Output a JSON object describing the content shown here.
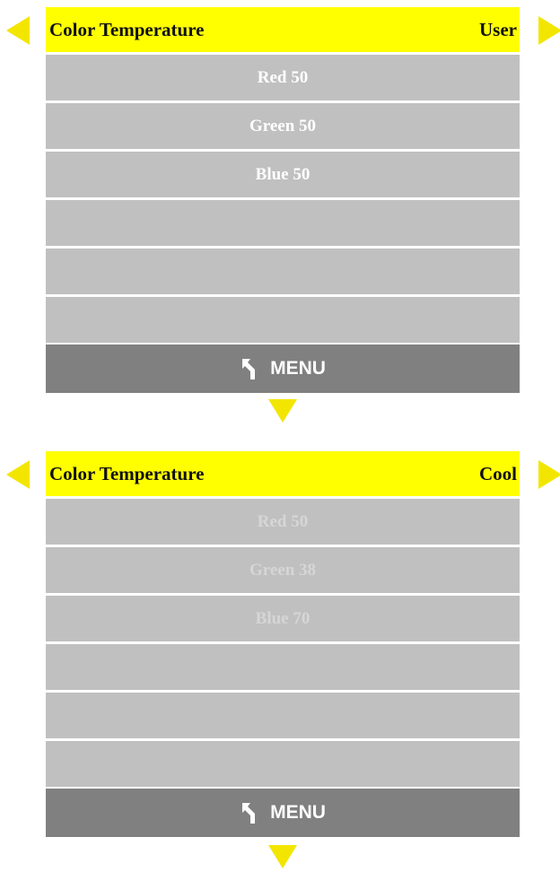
{
  "colors": {
    "header_bg": "#ffff00",
    "arrow": "#f2e600",
    "row_bg": "#c0c0c0",
    "footer_bg": "#808080"
  },
  "panels": [
    {
      "title": "Color Temperature",
      "mode": "User",
      "rows": [
        "Red 50",
        "Green 50",
        "Blue 50",
        "",
        "",
        ""
      ],
      "footer": {
        "icon": "return-arrow-icon",
        "label": "MENU"
      }
    },
    {
      "title": "Color Temperature",
      "mode": "Cool",
      "rows": [
        "Red 50",
        "Green 38",
        "Blue 70",
        "",
        "",
        ""
      ],
      "footer": {
        "icon": "return-arrow-icon",
        "label": "MENU"
      }
    }
  ]
}
